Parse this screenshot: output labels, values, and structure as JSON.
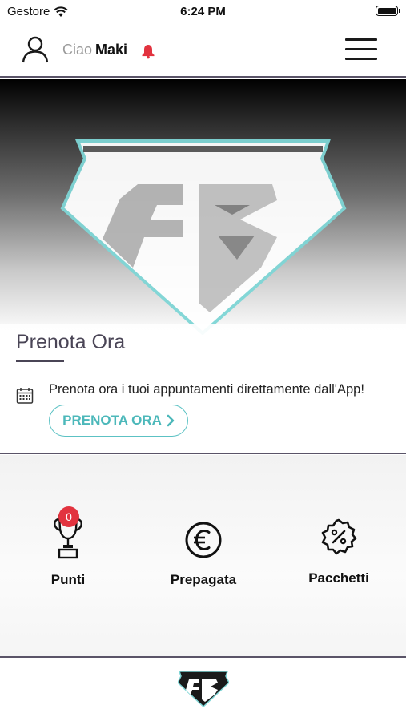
{
  "status_bar": {
    "carrier": "Gestore",
    "time": "6:24 PM"
  },
  "header": {
    "greeting_prefix": "Ciao",
    "user_name": "Maki"
  },
  "prenota": {
    "title": "Prenota Ora",
    "description": "Prenota ora i tuoi appuntamenti direttamente dall'App!",
    "button_label": "PRENOTA ORA"
  },
  "actions": [
    {
      "label": "Punti",
      "icon": "trophy-icon",
      "badge": "0"
    },
    {
      "label": "Prepagata",
      "icon": "euro-icon"
    },
    {
      "label": "Pacchetti",
      "icon": "discount-badge-icon"
    }
  ],
  "colors": {
    "accent": "#5cc2c4",
    "badge": "#e2333f",
    "bell": "#e2333f",
    "divider": "#5a5468",
    "title": "#4a4556"
  }
}
